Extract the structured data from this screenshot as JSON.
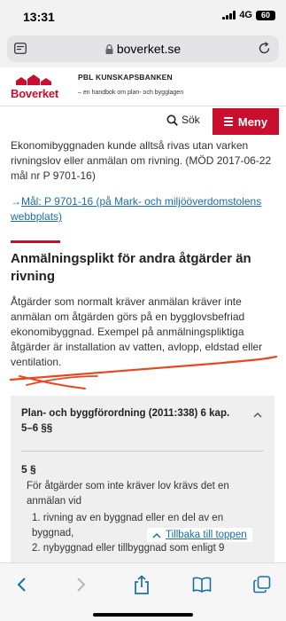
{
  "status": {
    "time": "13:31",
    "network": "4G",
    "battery": "60"
  },
  "browser": {
    "url": "boverket.se"
  },
  "site": {
    "logo_text": "Boverket",
    "title": "PBL KUNSKAPSBANKEN",
    "subtitle": "– en handbok om plan- och bygglagen",
    "search_label": "Sök",
    "menu_label": "Meny"
  },
  "content": {
    "intro": "Ekonomibyggnaden kunde alltså rivas utan varken rivningslov eller anmälan om rivning. (MÖD 2017-06-22 mål nr P 9701-16)",
    "ref_link": "Mål: P 9701-16 (på Mark- och miljööverdomstolens webbplats)",
    "heading": "Anmälningsplikt för andra åtgärder än rivning",
    "body": "Åtgärder som normalt kräver anmälan kräver inte anmälan om åtgärden görs på en bygglovsbefriad ekonomibyggnad. Exempel på anmälningspliktiga åtgärder är installation av vatten, avlopp, eldstad eller ventilation."
  },
  "accordion": {
    "title": "Plan- och byggförordning (2011:338) 6 kap. 5–6 §§",
    "paragraph": "5 §",
    "text": "För åtgärder som inte kräver lov krävs det en anmälan vid",
    "items": [
      "1. rivning av en byggnad eller en del av en byggnad,",
      "2. nybyggnad eller tillbyggnad som enligt 9"
    ]
  },
  "back_to_top": "Tillbaka till toppen",
  "colors": {
    "brand_red": "#c8102e",
    "link_blue": "#1a6fa6",
    "scribble": "#e8471f"
  },
  "icons": {
    "tab_switcher": "tabs-icon",
    "lock": "lock-icon",
    "reload": "reload-icon",
    "search": "search-icon",
    "back": "chevron-left-icon",
    "forward": "chevron-right-icon",
    "share": "share-icon",
    "bookmarks": "book-icon",
    "tabs": "tabs-overview-icon"
  }
}
